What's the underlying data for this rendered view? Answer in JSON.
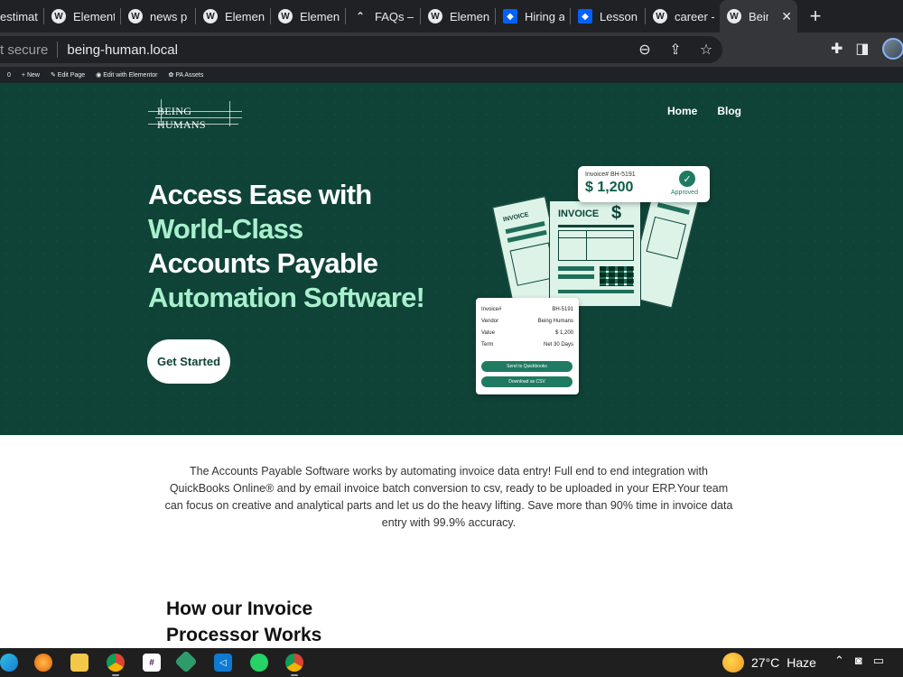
{
  "browser": {
    "tabs": [
      {
        "title": "estimat",
        "icon": "none"
      },
      {
        "title": "Element",
        "icon": "wordpress"
      },
      {
        "title": "news p",
        "icon": "wordpress"
      },
      {
        "title": "Elemen",
        "icon": "wordpress"
      },
      {
        "title": "Elemen",
        "icon": "wordpress"
      },
      {
        "title": "FAQs –",
        "icon": "caret"
      },
      {
        "title": "Elemen",
        "icon": "wordpress"
      },
      {
        "title": "Hiring a",
        "icon": "dropbox"
      },
      {
        "title": "Lesson",
        "icon": "dropbox"
      },
      {
        "title": "career -",
        "icon": "wordpress"
      },
      {
        "title": "Bein",
        "icon": "wordpress",
        "active": true
      }
    ],
    "new_tab": "+",
    "close": "✕",
    "security": "t secure",
    "url": "being-human.local"
  },
  "adminbar": {
    "count": "0",
    "new": "New",
    "edit_page": "Edit Page",
    "edit_elementor": "Edit with Elementor",
    "pa_assets": "PA Assets"
  },
  "site": {
    "logo": "BEING HUMANS",
    "nav": [
      "Home",
      "Blog"
    ]
  },
  "hero": {
    "line1": "Access Ease with",
    "line2": "World-Class",
    "line3": "Accounts Payable",
    "line4": "Automation Software!",
    "cta": "Get Started",
    "colors": {
      "bg": "#0f4337",
      "accent": "#a8f0cd"
    }
  },
  "illustration": {
    "invoice_word": "INVOICE",
    "dollar": "$",
    "badge": {
      "label": "Invoice# BH-5191",
      "amount": "$ 1,200",
      "status": "Approved"
    },
    "details": [
      {
        "k": "Invoice#",
        "v": "BH-5191"
      },
      {
        "k": "Vendor",
        "v": "Being Humans"
      },
      {
        "k": "Value",
        "v": "$ 1,200"
      },
      {
        "k": "Term",
        "v": "Net 30 Days"
      }
    ],
    "btn_qb": "Send to Quickbooks",
    "btn_csv": "Download as CSV"
  },
  "content": {
    "intro": "The Accounts Payable Software works by automating invoice data entry! Full end to end integration with QuickBooks Online® and by email invoice batch conversion to csv, ready to be uploaded in your ERP.Your team can focus on creative and analytical parts and let us do the heavy lifting. Save more than 90% time in invoice data entry with 99.9% accuracy.",
    "section_line1": "How our Invoice",
    "section_line2": "Processor Works"
  },
  "taskbar": {
    "temperature": "27°C",
    "weather": "Haze"
  }
}
